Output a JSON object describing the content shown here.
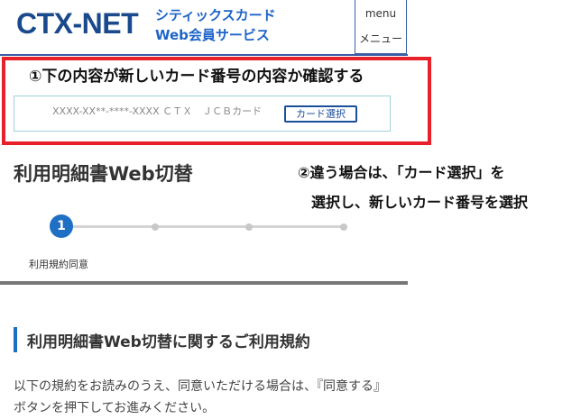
{
  "header": {
    "logo": "CTX-NET",
    "service_line1": "シティックスカード",
    "service_line2": "Web会員サービス",
    "menu_en": "menu",
    "menu_ja": "メニュー"
  },
  "annotations": {
    "note1": "①下の内容が新しいカード番号の内容か確認する",
    "note2_line1": "②違う場合は、「カード選択」を",
    "note2_line2": "選択し、新しいカード番号を選択"
  },
  "card": {
    "info": "XXXX-XX**-****-XXXX ＣＴＸ　ＪＣＢカード",
    "select_button": "カード選択"
  },
  "page_title": "利用明細書Web切替",
  "stepper": {
    "active_step": "1",
    "total_steps": 4,
    "current_label": "利用規約同意"
  },
  "section": {
    "title": "利用明細書Web切替に関するご利用規約",
    "body": "以下の規約をお読みのうえ、同意いただける場合は、『同意する』ボタンを押下してお進みください。"
  },
  "colors": {
    "brand": "#1a4a8c",
    "accent": "#1f6fc4",
    "annotation": "#e8202a"
  }
}
